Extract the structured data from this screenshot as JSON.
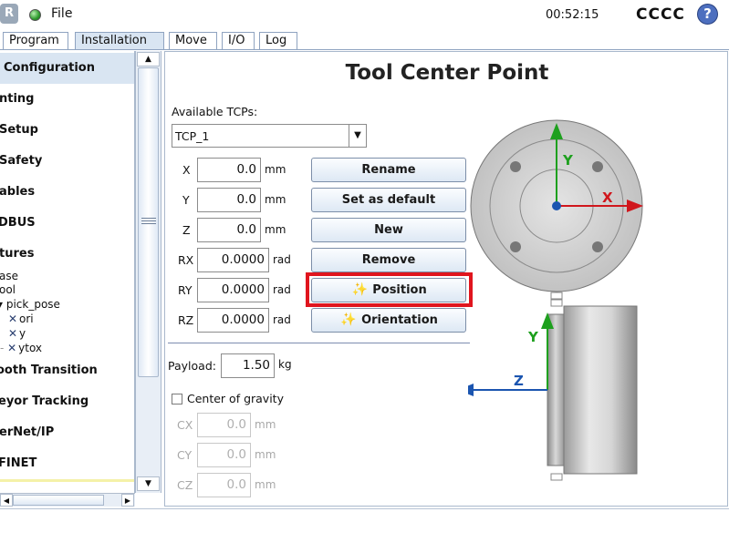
{
  "app": {
    "file_menu": "File",
    "clock": "00:52:15",
    "robot_name": "CCCC",
    "help_label": "?",
    "logo_label": "R"
  },
  "tabs": [
    {
      "label": "Program",
      "active": false
    },
    {
      "label": "Installation",
      "active": true
    },
    {
      "label": "Move",
      "active": false
    },
    {
      "label": "I/O",
      "active": false
    },
    {
      "label": "Log",
      "active": false
    }
  ],
  "sidebar": {
    "items": [
      {
        "label": "Configuration",
        "selected": true
      },
      {
        "label": "nting"
      },
      {
        "label": "Setup"
      },
      {
        "label": "Safety"
      },
      {
        "label": "ables"
      },
      {
        "label": "DBUS"
      },
      {
        "label": "tures"
      },
      {
        "label": "Smooth Transition"
      },
      {
        "label": "eyor Tracking"
      },
      {
        "label": "erNet/IP"
      },
      {
        "label": "FINET"
      }
    ],
    "smooth_label": "ooth Transition",
    "features": {
      "base": "ase",
      "tool": "ool",
      "pick_pose": "pick_pose",
      "children": [
        "ori",
        "y",
        "ytox"
      ]
    },
    "scroll_up": "▲",
    "scroll_down": "▼",
    "hscroll_left": "◀",
    "hscroll_right": "▶"
  },
  "main": {
    "title": "Tool Center Point",
    "available_tcps_label": "Available TCPs:",
    "tcp_selected": "TCP_1",
    "dropdown_arrow": "▼",
    "coords": [
      {
        "label": "X",
        "value": "0.0",
        "unit": "mm"
      },
      {
        "label": "Y",
        "value": "0.0",
        "unit": "mm"
      },
      {
        "label": "Z",
        "value": "0.0",
        "unit": "mm"
      },
      {
        "label": "RX",
        "value": "0.0000",
        "unit": "rad"
      },
      {
        "label": "RY",
        "value": "0.0000",
        "unit": "rad"
      },
      {
        "label": "RZ",
        "value": "0.0000",
        "unit": "rad"
      }
    ],
    "buttons": {
      "rename": "Rename",
      "set_default": "Set as default",
      "new": "New",
      "remove": "Remove",
      "position": "Position",
      "orientation": "Orientation"
    },
    "payload_label": "Payload:",
    "payload_value": "1.50",
    "payload_unit": "kg",
    "cog_label": "Center of gravity",
    "cog_checked": false,
    "cog": [
      {
        "label": "CX",
        "value": "0.0",
        "unit": "mm"
      },
      {
        "label": "CY",
        "value": "0.0",
        "unit": "mm"
      },
      {
        "label": "CZ",
        "value": "0.0",
        "unit": "mm"
      }
    ],
    "diagram": {
      "top_y": "Y",
      "top_x": "X",
      "side_y": "Y",
      "side_z": "Z"
    }
  },
  "colors": {
    "accent_blue": "#4d6fbf",
    "highlight_red": "#e0151e",
    "axis_red": "#d0161c",
    "axis_green": "#1ea01e",
    "axis_blue": "#1b55b0",
    "selected_bg": "#d9e5f2"
  }
}
